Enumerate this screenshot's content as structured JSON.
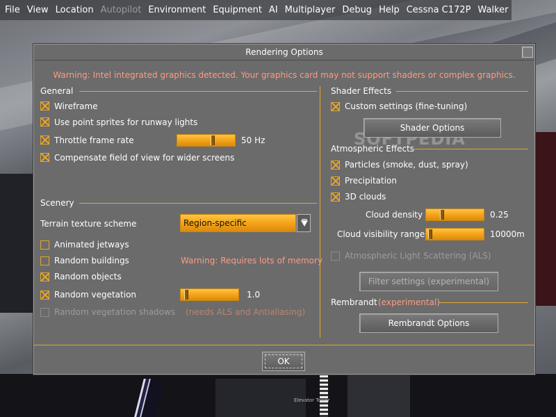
{
  "menubar": {
    "items": [
      {
        "label": "File",
        "enabled": true
      },
      {
        "label": "View",
        "enabled": true
      },
      {
        "label": "Location",
        "enabled": true
      },
      {
        "label": "Autopilot",
        "enabled": false
      },
      {
        "label": "Environment",
        "enabled": true
      },
      {
        "label": "Equipment",
        "enabled": true
      },
      {
        "label": "AI",
        "enabled": true
      },
      {
        "label": "Multiplayer",
        "enabled": true
      },
      {
        "label": "Debug",
        "enabled": true
      },
      {
        "label": "Help",
        "enabled": true
      },
      {
        "label": "Cessna C172P",
        "enabled": true
      },
      {
        "label": "Walker",
        "enabled": true
      }
    ]
  },
  "dialog": {
    "title": "Rendering Options",
    "warning": "Warning: Intel integrated graphics detected.  Your graphics card may not support shaders or complex graphics.",
    "general": {
      "heading": "General",
      "wireframe": {
        "label": "Wireframe",
        "checked": true
      },
      "point_sprites": {
        "label": "Use point sprites for runway lights",
        "checked": true
      },
      "throttle": {
        "label": "Throttle frame rate",
        "checked": true,
        "slider_fraction": 0.62,
        "value_text": "50 Hz"
      },
      "compensate_fov": {
        "label": "Compensate field of view for wider screens",
        "checked": true
      }
    },
    "scenery": {
      "heading": "Scenery",
      "terrain_label": "Terrain texture scheme",
      "terrain_value": "Region-specific",
      "animated_jetways": {
        "label": "Animated jetways",
        "checked": false
      },
      "random_buildings": {
        "label": "Random buildings",
        "checked": false
      },
      "buildings_warning": "Warning: Requires lots of memory",
      "random_objects": {
        "label": "Random objects",
        "checked": true
      },
      "random_vegetation": {
        "label": "Random vegetation",
        "checked": true,
        "slider_fraction": 0.05,
        "value_text": "1.0"
      },
      "vegetation_shadows": {
        "label": "Random vegetation shadows",
        "checked": false,
        "enabled": false
      },
      "shadows_note": "(needs ALS and Antialiasing)"
    },
    "shader_effects": {
      "heading": "Shader Effects",
      "custom_settings": {
        "label": "Custom settings (fine-tuning)",
        "checked": true
      },
      "shader_options_button": "Shader Options"
    },
    "atmospheric_effects": {
      "heading": "Atmospheric Effects",
      "particles": {
        "label": "Particles (smoke, dust, spray)",
        "checked": true
      },
      "precipitation": {
        "label": "Precipitation",
        "checked": true
      },
      "clouds_3d": {
        "label": "3D clouds",
        "checked": true
      },
      "cloud_density": {
        "label": "Cloud density",
        "slider_fraction": 0.25,
        "value_text": "0.25"
      },
      "cloud_visibility": {
        "label": "Cloud visibility range",
        "slider_fraction": 0.02,
        "value_text": "10000m"
      },
      "als": {
        "label": "Atmospheric Light Scattering (ALS)",
        "checked": false,
        "enabled": false
      },
      "filter_button": "Filter settings (experimental)"
    },
    "rembrandt": {
      "heading": "Rembrandt",
      "heading_note": "(experimental)",
      "button": "Rembrandt Options"
    },
    "ok_button": "OK"
  },
  "watermark": "SOFTPEDIA",
  "scene": {
    "sign_text": "Elevator Tower",
    "side_text": "......."
  },
  "colors": {
    "accent": "#e8a62a",
    "warning": "#ff9b83",
    "dialog_bg": "#6b6b6b"
  }
}
